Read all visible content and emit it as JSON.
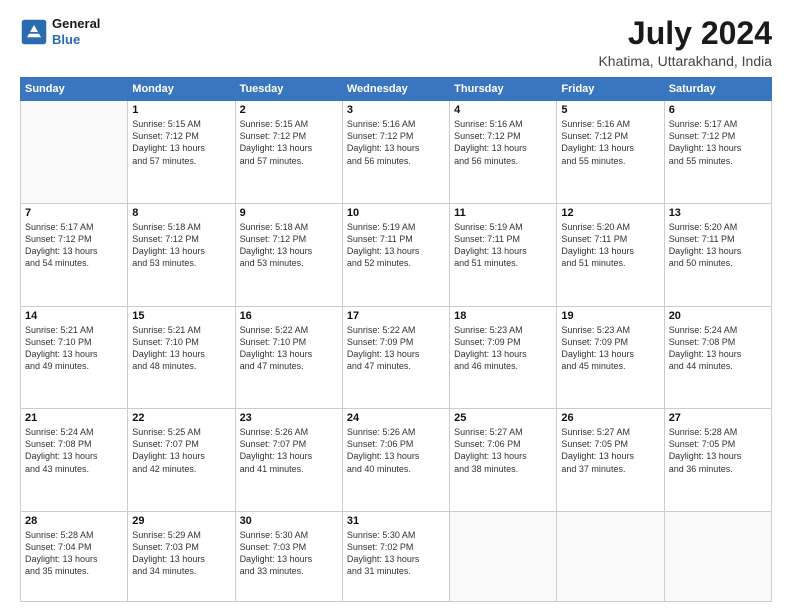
{
  "header": {
    "logo_line1": "General",
    "logo_line2": "Blue",
    "month_year": "July 2024",
    "location": "Khatima, Uttarakhand, India"
  },
  "days_of_week": [
    "Sunday",
    "Monday",
    "Tuesday",
    "Wednesday",
    "Thursday",
    "Friday",
    "Saturday"
  ],
  "weeks": [
    [
      {
        "day": "",
        "info": ""
      },
      {
        "day": "1",
        "info": "Sunrise: 5:15 AM\nSunset: 7:12 PM\nDaylight: 13 hours\nand 57 minutes."
      },
      {
        "day": "2",
        "info": "Sunrise: 5:15 AM\nSunset: 7:12 PM\nDaylight: 13 hours\nand 57 minutes."
      },
      {
        "day": "3",
        "info": "Sunrise: 5:16 AM\nSunset: 7:12 PM\nDaylight: 13 hours\nand 56 minutes."
      },
      {
        "day": "4",
        "info": "Sunrise: 5:16 AM\nSunset: 7:12 PM\nDaylight: 13 hours\nand 56 minutes."
      },
      {
        "day": "5",
        "info": "Sunrise: 5:16 AM\nSunset: 7:12 PM\nDaylight: 13 hours\nand 55 minutes."
      },
      {
        "day": "6",
        "info": "Sunrise: 5:17 AM\nSunset: 7:12 PM\nDaylight: 13 hours\nand 55 minutes."
      }
    ],
    [
      {
        "day": "7",
        "info": "Sunrise: 5:17 AM\nSunset: 7:12 PM\nDaylight: 13 hours\nand 54 minutes."
      },
      {
        "day": "8",
        "info": "Sunrise: 5:18 AM\nSunset: 7:12 PM\nDaylight: 13 hours\nand 53 minutes."
      },
      {
        "day": "9",
        "info": "Sunrise: 5:18 AM\nSunset: 7:12 PM\nDaylight: 13 hours\nand 53 minutes."
      },
      {
        "day": "10",
        "info": "Sunrise: 5:19 AM\nSunset: 7:11 PM\nDaylight: 13 hours\nand 52 minutes."
      },
      {
        "day": "11",
        "info": "Sunrise: 5:19 AM\nSunset: 7:11 PM\nDaylight: 13 hours\nand 51 minutes."
      },
      {
        "day": "12",
        "info": "Sunrise: 5:20 AM\nSunset: 7:11 PM\nDaylight: 13 hours\nand 51 minutes."
      },
      {
        "day": "13",
        "info": "Sunrise: 5:20 AM\nSunset: 7:11 PM\nDaylight: 13 hours\nand 50 minutes."
      }
    ],
    [
      {
        "day": "14",
        "info": "Sunrise: 5:21 AM\nSunset: 7:10 PM\nDaylight: 13 hours\nand 49 minutes."
      },
      {
        "day": "15",
        "info": "Sunrise: 5:21 AM\nSunset: 7:10 PM\nDaylight: 13 hours\nand 48 minutes."
      },
      {
        "day": "16",
        "info": "Sunrise: 5:22 AM\nSunset: 7:10 PM\nDaylight: 13 hours\nand 47 minutes."
      },
      {
        "day": "17",
        "info": "Sunrise: 5:22 AM\nSunset: 7:09 PM\nDaylight: 13 hours\nand 47 minutes."
      },
      {
        "day": "18",
        "info": "Sunrise: 5:23 AM\nSunset: 7:09 PM\nDaylight: 13 hours\nand 46 minutes."
      },
      {
        "day": "19",
        "info": "Sunrise: 5:23 AM\nSunset: 7:09 PM\nDaylight: 13 hours\nand 45 minutes."
      },
      {
        "day": "20",
        "info": "Sunrise: 5:24 AM\nSunset: 7:08 PM\nDaylight: 13 hours\nand 44 minutes."
      }
    ],
    [
      {
        "day": "21",
        "info": "Sunrise: 5:24 AM\nSunset: 7:08 PM\nDaylight: 13 hours\nand 43 minutes."
      },
      {
        "day": "22",
        "info": "Sunrise: 5:25 AM\nSunset: 7:07 PM\nDaylight: 13 hours\nand 42 minutes."
      },
      {
        "day": "23",
        "info": "Sunrise: 5:26 AM\nSunset: 7:07 PM\nDaylight: 13 hours\nand 41 minutes."
      },
      {
        "day": "24",
        "info": "Sunrise: 5:26 AM\nSunset: 7:06 PM\nDaylight: 13 hours\nand 40 minutes."
      },
      {
        "day": "25",
        "info": "Sunrise: 5:27 AM\nSunset: 7:06 PM\nDaylight: 13 hours\nand 38 minutes."
      },
      {
        "day": "26",
        "info": "Sunrise: 5:27 AM\nSunset: 7:05 PM\nDaylight: 13 hours\nand 37 minutes."
      },
      {
        "day": "27",
        "info": "Sunrise: 5:28 AM\nSunset: 7:05 PM\nDaylight: 13 hours\nand 36 minutes."
      }
    ],
    [
      {
        "day": "28",
        "info": "Sunrise: 5:28 AM\nSunset: 7:04 PM\nDaylight: 13 hours\nand 35 minutes."
      },
      {
        "day": "29",
        "info": "Sunrise: 5:29 AM\nSunset: 7:03 PM\nDaylight: 13 hours\nand 34 minutes."
      },
      {
        "day": "30",
        "info": "Sunrise: 5:30 AM\nSunset: 7:03 PM\nDaylight: 13 hours\nand 33 minutes."
      },
      {
        "day": "31",
        "info": "Sunrise: 5:30 AM\nSunset: 7:02 PM\nDaylight: 13 hours\nand 31 minutes."
      },
      {
        "day": "",
        "info": ""
      },
      {
        "day": "",
        "info": ""
      },
      {
        "day": "",
        "info": ""
      }
    ]
  ]
}
